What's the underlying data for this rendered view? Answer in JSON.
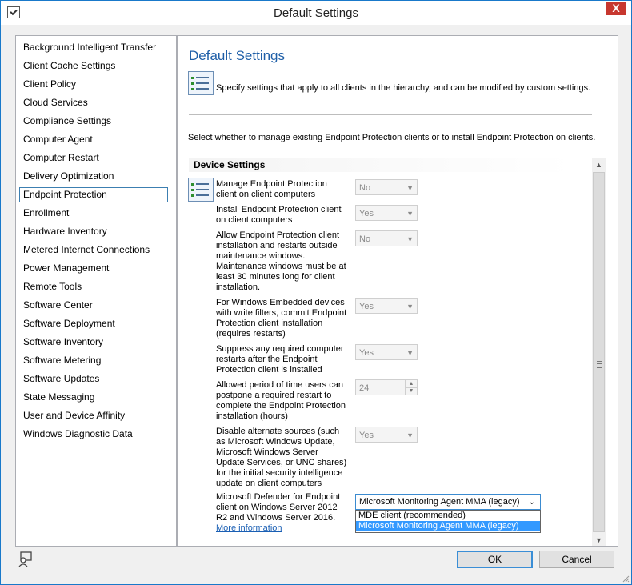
{
  "window": {
    "title": "Default Settings",
    "close_label": "X"
  },
  "nav": {
    "items": [
      "Background Intelligent Transfer",
      "Client Cache Settings",
      "Client Policy",
      "Cloud Services",
      "Compliance Settings",
      "Computer Agent",
      "Computer Restart",
      "Delivery Optimization",
      "Endpoint Protection",
      "Enrollment",
      "Hardware Inventory",
      "Metered Internet Connections",
      "Power Management",
      "Remote Tools",
      "Software Center",
      "Software Deployment",
      "Software Inventory",
      "Software Metering",
      "Software Updates",
      "State Messaging",
      "User and Device Affinity",
      "Windows Diagnostic Data"
    ],
    "selected": "Endpoint Protection"
  },
  "content": {
    "title": "Default Settings",
    "description": "Specify settings that apply to all clients in the hierarchy, and can be modified by custom settings.",
    "instruction": "Select whether to manage existing Endpoint Protection clients or to install Endpoint Protection on clients.",
    "section_header": "Device Settings",
    "settings": [
      {
        "label": "Manage Endpoint Protection client on client computers",
        "value": "No"
      },
      {
        "label": "Install Endpoint Protection client on client computers",
        "value": "Yes"
      },
      {
        "label": "Allow Endpoint Protection client installation and restarts outside maintenance windows. Maintenance windows must be at least 30 minutes long for client installation.",
        "value": "No"
      },
      {
        "label": "For Windows Embedded devices with write filters, commit Endpoint Protection client installation (requires restarts)",
        "value": "Yes"
      },
      {
        "label": "Suppress any required computer restarts after the Endpoint Protection client is installed",
        "value": "Yes"
      },
      {
        "label": "Allowed period of time users can postpone a required restart to complete the Endpoint Protection installation (hours)",
        "value": "24"
      },
      {
        "label": "Disable alternate sources (such as Microsoft Windows Update, Microsoft Windows Server Update Services, or UNC shares) for the initial security intelligence update on client computers",
        "value": "Yes"
      },
      {
        "label": "Microsoft Defender for Endpoint client on Windows Server 2012 R2 and Windows Server 2016.",
        "value": "Microsoft Monitoring Agent MMA (legacy)"
      }
    ],
    "more_info": "More information",
    "dropdown_options": [
      "MDE client (recommended)",
      "Microsoft Monitoring Agent MMA (legacy)"
    ]
  },
  "buttons": {
    "ok": "OK",
    "cancel": "Cancel"
  }
}
